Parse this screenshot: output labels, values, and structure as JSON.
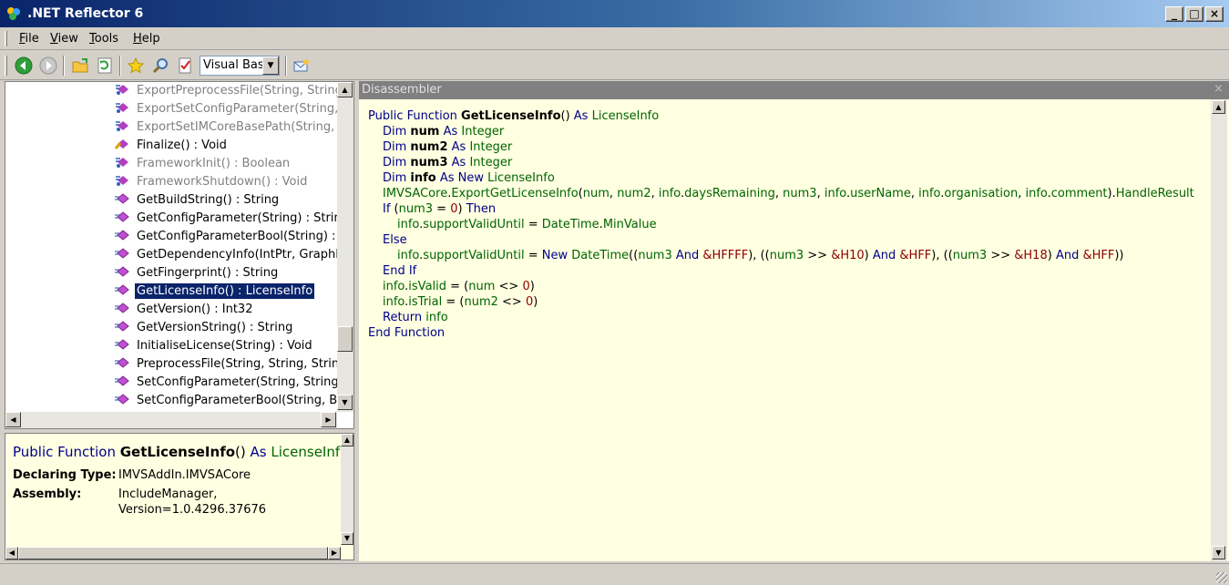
{
  "window": {
    "title": ".NET Reflector 6"
  },
  "menu": {
    "items": [
      {
        "u": "F",
        "rest": "ile"
      },
      {
        "u": "V",
        "rest": "iew"
      },
      {
        "u": "T",
        "rest": "ools"
      },
      {
        "u": "H",
        "rest": "elp"
      }
    ]
  },
  "toolbar": {
    "language": "Visual Basic"
  },
  "tree": {
    "items": [
      {
        "label": "ExportPreprocessFile(String, String, ",
        "icon": "method-link-icon",
        "gray": true
      },
      {
        "label": "ExportSetConfigParameter(String, S",
        "icon": "method-link-icon",
        "gray": true
      },
      {
        "label": "ExportSetIMCoreBasePath(String, St",
        "icon": "method-link-icon",
        "gray": true
      },
      {
        "label": "Finalize() : Void",
        "icon": "finalize-method-icon",
        "gray": false
      },
      {
        "label": "FrameworkInit() : Boolean",
        "icon": "method-link-icon",
        "gray": true
      },
      {
        "label": "FrameworkShutdown() : Void",
        "icon": "method-link-icon",
        "gray": true
      },
      {
        "label": "GetBuildString() : String",
        "icon": "method-icon",
        "gray": false
      },
      {
        "label": "GetConfigParameter(String) : String",
        "icon": "method-icon",
        "gray": false
      },
      {
        "label": "GetConfigParameterBool(String) : Bo",
        "icon": "method-icon",
        "gray": false
      },
      {
        "label": "GetDependencyInfo(IntPtr, GraphRe",
        "icon": "method-icon",
        "gray": false
      },
      {
        "label": "GetFingerprint() : String",
        "icon": "method-icon",
        "gray": false
      },
      {
        "label": "GetLicenseInfo() : LicenseInfo",
        "icon": "method-icon",
        "gray": false,
        "selected": true
      },
      {
        "label": "GetVersion() : Int32",
        "icon": "method-icon",
        "gray": false
      },
      {
        "label": "GetVersionString() : String",
        "icon": "method-icon",
        "gray": false
      },
      {
        "label": "InitialiseLicense(String) : Void",
        "icon": "method-icon",
        "gray": false
      },
      {
        "label": "PreprocessFile(String, String, String,",
        "icon": "method-icon",
        "gray": false
      },
      {
        "label": "SetConfigParameter(String, String) :",
        "icon": "method-icon",
        "gray": false
      },
      {
        "label": "SetConfigParameterBool(String, Boo",
        "icon": "method-icon",
        "gray": false
      }
    ]
  },
  "info": {
    "sig_kw": "Public Function ",
    "sig_name": "GetLicenseInfo",
    "sig_parens": "() ",
    "sig_as": "As ",
    "sig_type": "LicenseInfo",
    "declaring_type_label": "Declaring Type:",
    "declaring_type_value": "IMVSAddIn.IMVSACore",
    "assembly_label": "Assembly:",
    "assembly_value_1": "IncludeManager,",
    "assembly_value_2": "Version=1.0.4296.37676"
  },
  "disassembler": {
    "title": "Disassembler",
    "close": "×",
    "lines": [
      {
        "indent": 0,
        "tokens": [
          [
            "kw",
            "Public Function "
          ],
          [
            "bold",
            "GetLicenseInfo"
          ],
          [
            "op",
            "() "
          ],
          [
            "kw",
            "As "
          ],
          [
            "id",
            "LicenseInfo"
          ]
        ]
      },
      {
        "indent": 1,
        "tokens": [
          [
            "kw",
            "Dim "
          ],
          [
            "bold",
            "num"
          ],
          [
            "kw",
            " As "
          ],
          [
            "id",
            "Integer"
          ]
        ]
      },
      {
        "indent": 1,
        "tokens": [
          [
            "kw",
            "Dim "
          ],
          [
            "bold",
            "num2"
          ],
          [
            "kw",
            " As "
          ],
          [
            "id",
            "Integer"
          ]
        ]
      },
      {
        "indent": 1,
        "tokens": [
          [
            "kw",
            "Dim "
          ],
          [
            "bold",
            "num3"
          ],
          [
            "kw",
            " As "
          ],
          [
            "id",
            "Integer"
          ]
        ]
      },
      {
        "indent": 1,
        "tokens": [
          [
            "kw",
            "Dim "
          ],
          [
            "bold",
            "info"
          ],
          [
            "kw",
            " As New "
          ],
          [
            "id",
            "LicenseInfo"
          ]
        ]
      },
      {
        "indent": 1,
        "tokens": [
          [
            "id",
            "IMVSACore"
          ],
          [
            "op",
            "."
          ],
          [
            "id",
            "ExportGetLicenseInfo"
          ],
          [
            "op",
            "("
          ],
          [
            "id",
            "num"
          ],
          [
            "op",
            ", "
          ],
          [
            "id",
            "num2"
          ],
          [
            "op",
            ", "
          ],
          [
            "id",
            "info"
          ],
          [
            "op",
            "."
          ],
          [
            "id",
            "daysRemaining"
          ],
          [
            "op",
            ", "
          ],
          [
            "id",
            "num3"
          ],
          [
            "op",
            ", "
          ],
          [
            "id",
            "info"
          ],
          [
            "op",
            "."
          ],
          [
            "id",
            "userName"
          ],
          [
            "op",
            ", "
          ],
          [
            "id",
            "info"
          ],
          [
            "op",
            "."
          ],
          [
            "id",
            "organisation"
          ],
          [
            "op",
            ", "
          ],
          [
            "id",
            "info"
          ],
          [
            "op",
            "."
          ],
          [
            "id",
            "comment"
          ],
          [
            "op",
            ")."
          ],
          [
            "id",
            "HandleResult"
          ]
        ]
      },
      {
        "indent": 1,
        "tokens": [
          [
            "kw",
            "If "
          ],
          [
            "op",
            "("
          ],
          [
            "id",
            "num3"
          ],
          [
            "op",
            " = "
          ],
          [
            "num",
            "0"
          ],
          [
            "op",
            ") "
          ],
          [
            "kw",
            "Then"
          ]
        ]
      },
      {
        "indent": 2,
        "tokens": [
          [
            "id",
            "info"
          ],
          [
            "op",
            "."
          ],
          [
            "id",
            "supportValidUntil"
          ],
          [
            "op",
            " = "
          ],
          [
            "id",
            "DateTime"
          ],
          [
            "op",
            "."
          ],
          [
            "id",
            "MinValue"
          ]
        ]
      },
      {
        "indent": 1,
        "tokens": [
          [
            "kw",
            "Else"
          ]
        ]
      },
      {
        "indent": 2,
        "tokens": [
          [
            "id",
            "info"
          ],
          [
            "op",
            "."
          ],
          [
            "id",
            "supportValidUntil"
          ],
          [
            "op",
            " = "
          ],
          [
            "kw",
            "New "
          ],
          [
            "id",
            "DateTime"
          ],
          [
            "op",
            "(("
          ],
          [
            "id",
            "num3"
          ],
          [
            "kw",
            " And "
          ],
          [
            "num",
            "&HFFFF"
          ],
          [
            "op",
            "), (("
          ],
          [
            "id",
            "num3"
          ],
          [
            "op",
            " >> "
          ],
          [
            "num",
            "&H10"
          ],
          [
            "op",
            ") "
          ],
          [
            "kw",
            "And "
          ],
          [
            "num",
            "&HFF"
          ],
          [
            "op",
            "), (("
          ],
          [
            "id",
            "num3"
          ],
          [
            "op",
            " >> "
          ],
          [
            "num",
            "&H18"
          ],
          [
            "op",
            ") "
          ],
          [
            "kw",
            "And "
          ],
          [
            "num",
            "&HFF"
          ],
          [
            "op",
            "))"
          ]
        ]
      },
      {
        "indent": 1,
        "tokens": [
          [
            "kw",
            "End If"
          ]
        ]
      },
      {
        "indent": 1,
        "tokens": [
          [
            "id",
            "info"
          ],
          [
            "op",
            "."
          ],
          [
            "id",
            "isValid"
          ],
          [
            "op",
            " = ("
          ],
          [
            "id",
            "num"
          ],
          [
            "op",
            " <> "
          ],
          [
            "num",
            "0"
          ],
          [
            "op",
            ")"
          ]
        ]
      },
      {
        "indent": 1,
        "tokens": [
          [
            "id",
            "info"
          ],
          [
            "op",
            "."
          ],
          [
            "id",
            "isTrial"
          ],
          [
            "op",
            " = ("
          ],
          [
            "id",
            "num2"
          ],
          [
            "op",
            " <> "
          ],
          [
            "num",
            "0"
          ],
          [
            "op",
            ")"
          ]
        ]
      },
      {
        "indent": 1,
        "tokens": [
          [
            "kw",
            "Return "
          ],
          [
            "id",
            "info"
          ]
        ]
      },
      {
        "indent": 0,
        "tokens": [
          [
            "kw",
            "End Function"
          ]
        ]
      }
    ]
  },
  "colors": {
    "keyword": "#00008b",
    "identifier": "#006400",
    "number": "#8b0000",
    "code_bg": "#ffffe1"
  }
}
